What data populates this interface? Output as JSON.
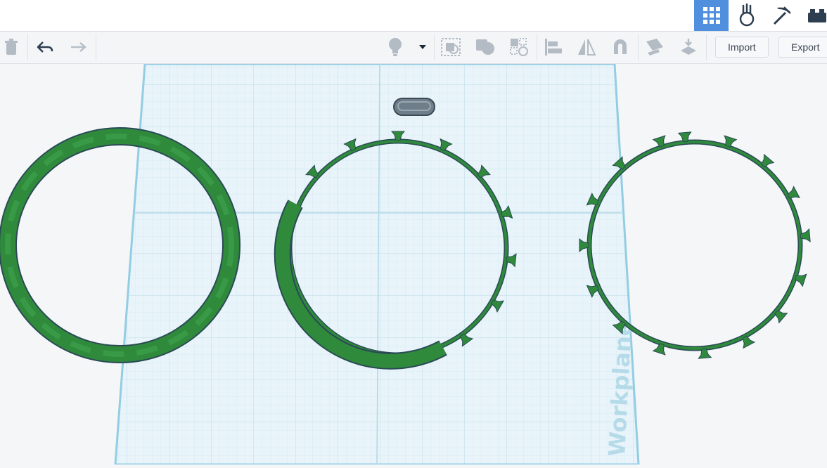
{
  "topbar": {
    "mode_buttons": [
      {
        "name": "3d-design-grid-icon",
        "active": true
      },
      {
        "name": "codeblocks-icon",
        "active": false
      },
      {
        "name": "minecraft-pickaxe-icon",
        "active": false
      },
      {
        "name": "bricks-icon",
        "active": false
      }
    ]
  },
  "toolbar": {
    "import_label": "Import",
    "export_label": "Export",
    "icons": [
      "trash-icon",
      "undo-icon",
      "redo-icon",
      "lightbulb-icon",
      "dropdown-arrow-icon",
      "group-icon",
      "ungroup-icon",
      "solid-hole-icon",
      "align-icon",
      "mirror-icon",
      "magnet-icon",
      "workplane-icon",
      "ruler-icon"
    ]
  },
  "workplane": {
    "label": "Workplane",
    "grid_color": "#c9e4ef",
    "plane_color": "#e6f3f8"
  },
  "shapes": {
    "ring_color": "#2f8a3c",
    "ring_edge_color": "#2a4a55",
    "selection_color": "#6e7e8a"
  },
  "colors": {
    "accent": "#4f8fde",
    "icon": "#8f9aa5",
    "icon_dark": "#2d3e50"
  }
}
